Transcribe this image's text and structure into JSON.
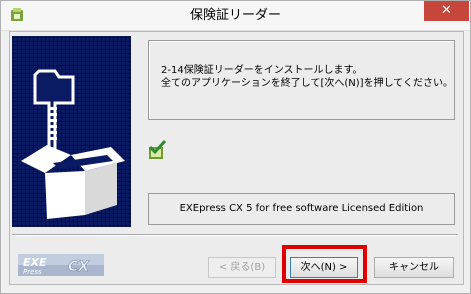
{
  "window": {
    "title": "保険証リーダー",
    "close_glyph": "✕"
  },
  "message": {
    "line1": "2-14保険証リーダーをインストールします。",
    "line2": "全てのアプリケーションを終了して[次へ(N)]を押してください。"
  },
  "edition_text": "EXEpress CX 5 for free software Licensed Edition",
  "logo": {
    "text1": "EXE",
    "text2": "Press",
    "text3": "CX"
  },
  "buttons": {
    "back": "< 戻る(B)",
    "next": "次へ(N) >",
    "cancel": "キャンセル"
  },
  "colors": {
    "hero_bg": "#0a1a63",
    "close_bg": "#c7463b",
    "highlight": "#e00000"
  },
  "icons": [
    "installer-app-icon",
    "close-icon",
    "box-folder-illustration",
    "checkmark-icon",
    "exepress-logo"
  ]
}
